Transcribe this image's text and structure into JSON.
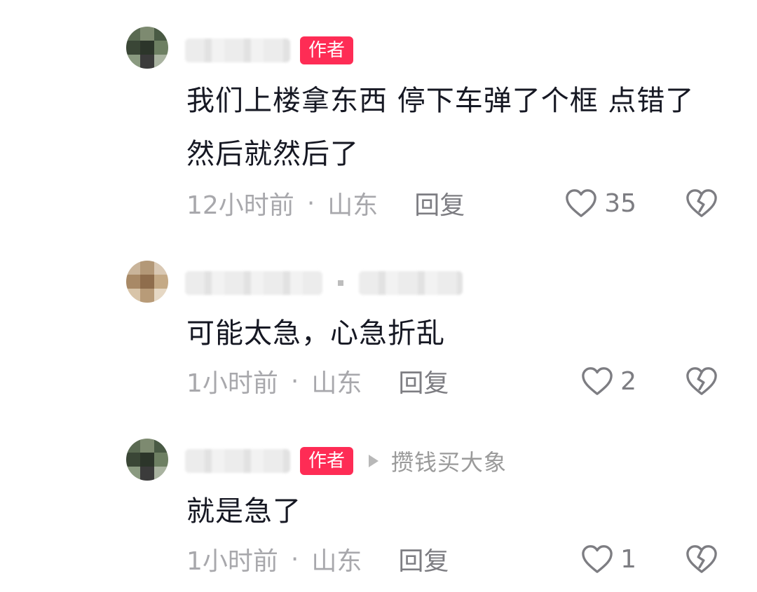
{
  "comments": [
    {
      "author_badge": "作者",
      "text": "我们上楼拿东西 停下车弹了个框 点错了 然后就然后了",
      "time": "12小时前",
      "separator": "·",
      "location": "山东",
      "reply_label": "回复",
      "likes": "35",
      "heart_icon": "heart-outline-icon",
      "dislike_icon": "broken-heart-icon"
    },
    {
      "text": "可能太急，心急折乱",
      "time": "1小时前",
      "separator": "·",
      "location": "山东",
      "reply_label": "回复",
      "likes": "2",
      "heart_icon": "heart-outline-icon",
      "dislike_icon": "broken-heart-icon"
    },
    {
      "author_badge": "作者",
      "reply_to": "攒钱买大象",
      "text": "就是急了",
      "time": "1小时前",
      "separator": "·",
      "location": "山东",
      "reply_label": "回复",
      "likes": "1",
      "heart_icon": "heart-outline-icon",
      "dislike_icon": "broken-heart-icon"
    }
  ],
  "colors": {
    "badge": "#fe2c55",
    "text": "#161823",
    "meta": "#a8a8ac",
    "icon": "#7d7d82"
  }
}
